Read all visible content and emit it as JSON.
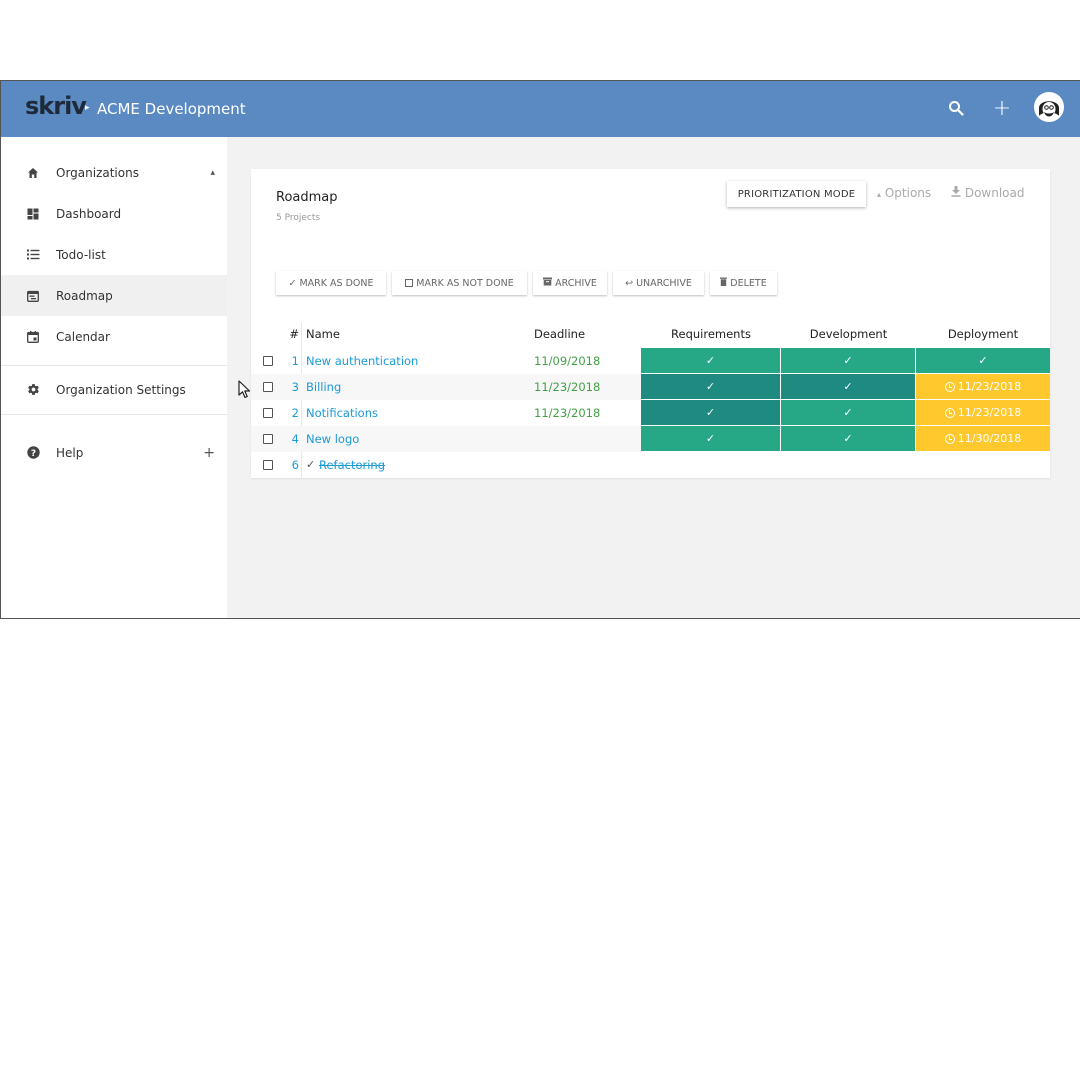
{
  "topbar": {
    "logo": "skriv",
    "breadcrumb_separator": "▸",
    "org_name": "ACME Development",
    "search_icon": "search-icon",
    "add_icon": "plus-icon",
    "add_label": "+",
    "avatar_icon": "user-avatar",
    "color": "#5b8ac2"
  },
  "sidebar": {
    "items": [
      {
        "label": "Organizations",
        "icon": "home-icon",
        "trail": "▴"
      },
      {
        "label": "Dashboard",
        "icon": "dashboard-icon"
      },
      {
        "label": "Todo-list",
        "icon": "list-icon"
      },
      {
        "label": "Roadmap",
        "icon": "roadmap-icon",
        "active": true
      },
      {
        "label": "Calendar",
        "icon": "calendar-icon"
      },
      {
        "label": "Organization Settings",
        "icon": "gear-icon"
      },
      {
        "label": "Help",
        "icon": "help-icon",
        "trail": "+"
      }
    ]
  },
  "card": {
    "title": "Roadmap",
    "subtitle": "5 Projects",
    "prioritization_label": "PRIORITIZATION MODE",
    "options_label": "Options",
    "download_label": "Download",
    "actions": {
      "mark_done": "MARK AS DONE",
      "mark_not_done": "MARK AS NOT DONE",
      "archive": "ARCHIVE",
      "unarchive": "UNARCHIVE",
      "delete": "DELETE"
    }
  },
  "table": {
    "headers": {
      "num": "#",
      "name": "Name",
      "deadline": "Deadline",
      "requirements": "Requirements",
      "development": "Development",
      "deployment": "Deployment"
    },
    "check_glyph": "✓",
    "rows": [
      {
        "num": "1",
        "name": "New authentication",
        "deadline": "11/09/2018",
        "dep_date": ""
      },
      {
        "num": "3",
        "name": "Billing",
        "deadline": "11/23/2018",
        "dep_date": "11/23/2018"
      },
      {
        "num": "2",
        "name": "Notifications",
        "deadline": "11/23/2018",
        "dep_date": "11/23/2018"
      },
      {
        "num": "4",
        "name": "New logo",
        "deadline": "",
        "dep_date": "11/30/2018"
      },
      {
        "num": "6",
        "name": "Refactoring",
        "deadline": "",
        "dep_date": "",
        "done": true
      }
    ]
  },
  "colors": {
    "accent_blue": "#1a9ad8",
    "deadline_green": "#43a047",
    "status_green": "#26a886",
    "status_dark_teal": "#1f8a80",
    "status_yellow": "#ffc82c"
  }
}
